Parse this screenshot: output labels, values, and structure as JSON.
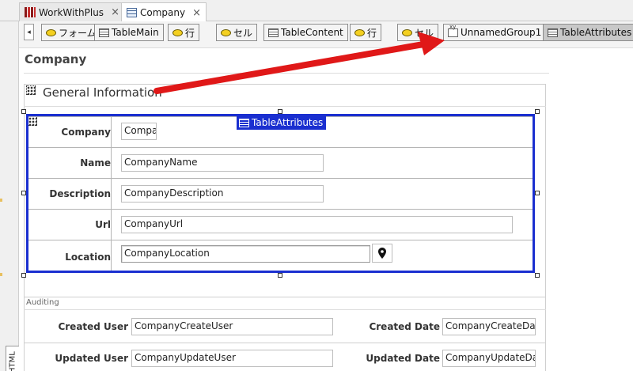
{
  "tabs": [
    {
      "label": "WorkWithPlus",
      "close": "×"
    },
    {
      "label": "Company",
      "close": "×"
    }
  ],
  "toolbar": {
    "scroll_left": "◂",
    "crumbs": [
      "フォーム",
      "TableMain",
      "行",
      "セル",
      "TableContent",
      "行",
      "セル",
      "UnnamedGroup1",
      "TableAttributes"
    ]
  },
  "page": {
    "title": "Company"
  },
  "general": {
    "header": "General Information"
  },
  "table_label": "TableAttributes",
  "attributes": [
    {
      "label": "Company",
      "value": "Compar"
    },
    {
      "label": "Name",
      "value": "CompanyName"
    },
    {
      "label": "Description",
      "value": "CompanyDescription"
    },
    {
      "label": "Url",
      "value": "CompanyUrl"
    },
    {
      "label": "Location",
      "value": "CompanyLocation"
    }
  ],
  "auditing": {
    "title": "Auditing",
    "created_user_label": "Created User",
    "created_user_value": "CompanyCreateUser",
    "created_date_label": "Created Date",
    "created_date_value": "CompanyCreateDate",
    "updated_user_label": "Updated User",
    "updated_user_value": "CompanyUpdateUser",
    "updated_date_label": "Updated Date",
    "updated_date_value": "CompanyUpdateDate"
  },
  "side": {
    "html_tab": "HTML"
  },
  "colors": {
    "selection": "#1a2fd0",
    "arrow": "#e01818"
  }
}
